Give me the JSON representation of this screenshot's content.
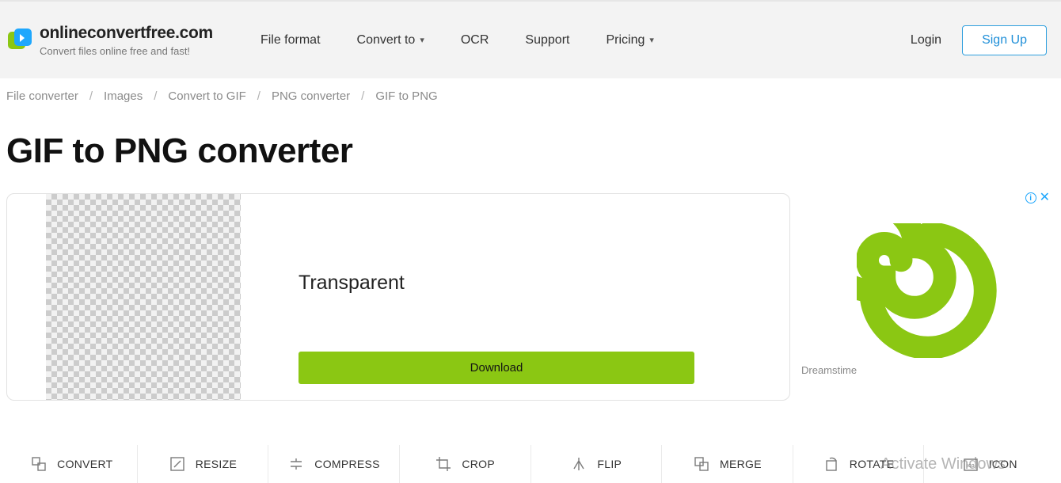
{
  "brand": {
    "name": "onlineconvertfree.com",
    "tagline": "Convert files online free and fast!"
  },
  "nav": {
    "file_format": "File format",
    "convert_to": "Convert to",
    "ocr": "OCR",
    "support": "Support",
    "pricing": "Pricing"
  },
  "auth": {
    "login": "Login",
    "signup": "Sign Up"
  },
  "breadcrumb": [
    "File converter",
    "Images",
    "Convert to GIF",
    "PNG converter",
    "GIF to PNG"
  ],
  "page_title": "GIF to PNG converter",
  "preview": {
    "label": "Transparent",
    "download": "Download"
  },
  "ad": {
    "caption": "Dreamstime"
  },
  "tools": {
    "convert": "CONVERT",
    "resize": "RESIZE",
    "compress": "COMPRESS",
    "crop": "CROP",
    "flip": "FLIP",
    "merge": "MERGE",
    "rotate": "ROTATE",
    "icon": "ICON"
  },
  "watermark": "Activate Windows"
}
